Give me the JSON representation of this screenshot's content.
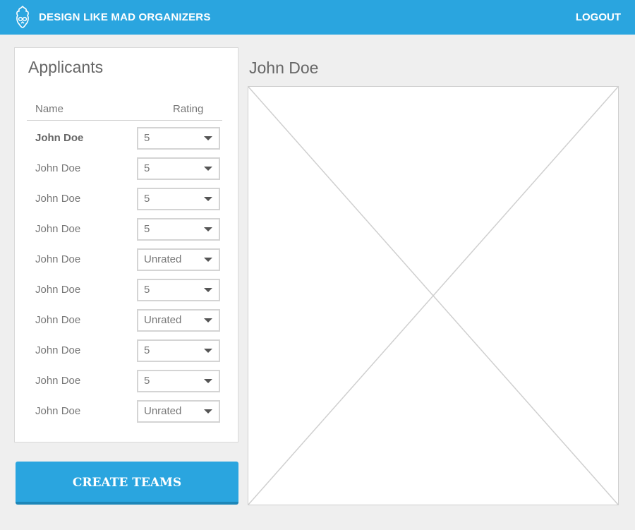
{
  "header": {
    "app_title": "DESIGN LIKE MAD ORGANIZERS",
    "logout_label": "LOGOUT",
    "logo_icon": "flame-skull-icon",
    "bar_color": "#2aa5df"
  },
  "applicants": {
    "title": "Applicants",
    "columns": {
      "name": "Name",
      "rating": "Rating"
    },
    "rows": [
      {
        "name": "John Doe",
        "rating": "5",
        "selected": true
      },
      {
        "name": "John Doe",
        "rating": "5"
      },
      {
        "name": "John Doe",
        "rating": "5"
      },
      {
        "name": "John Doe",
        "rating": "5"
      },
      {
        "name": "John Doe",
        "rating": "Unrated"
      },
      {
        "name": "John Doe",
        "rating": "5"
      },
      {
        "name": "John Doe",
        "rating": "Unrated"
      },
      {
        "name": "John Doe",
        "rating": "5"
      },
      {
        "name": "John Doe",
        "rating": "5"
      },
      {
        "name": "John Doe",
        "rating": "Unrated"
      }
    ]
  },
  "actions": {
    "create_teams_label": "CREATE TEAMS"
  },
  "detail": {
    "title": "John Doe",
    "image_icon": "image-placeholder-icon"
  }
}
